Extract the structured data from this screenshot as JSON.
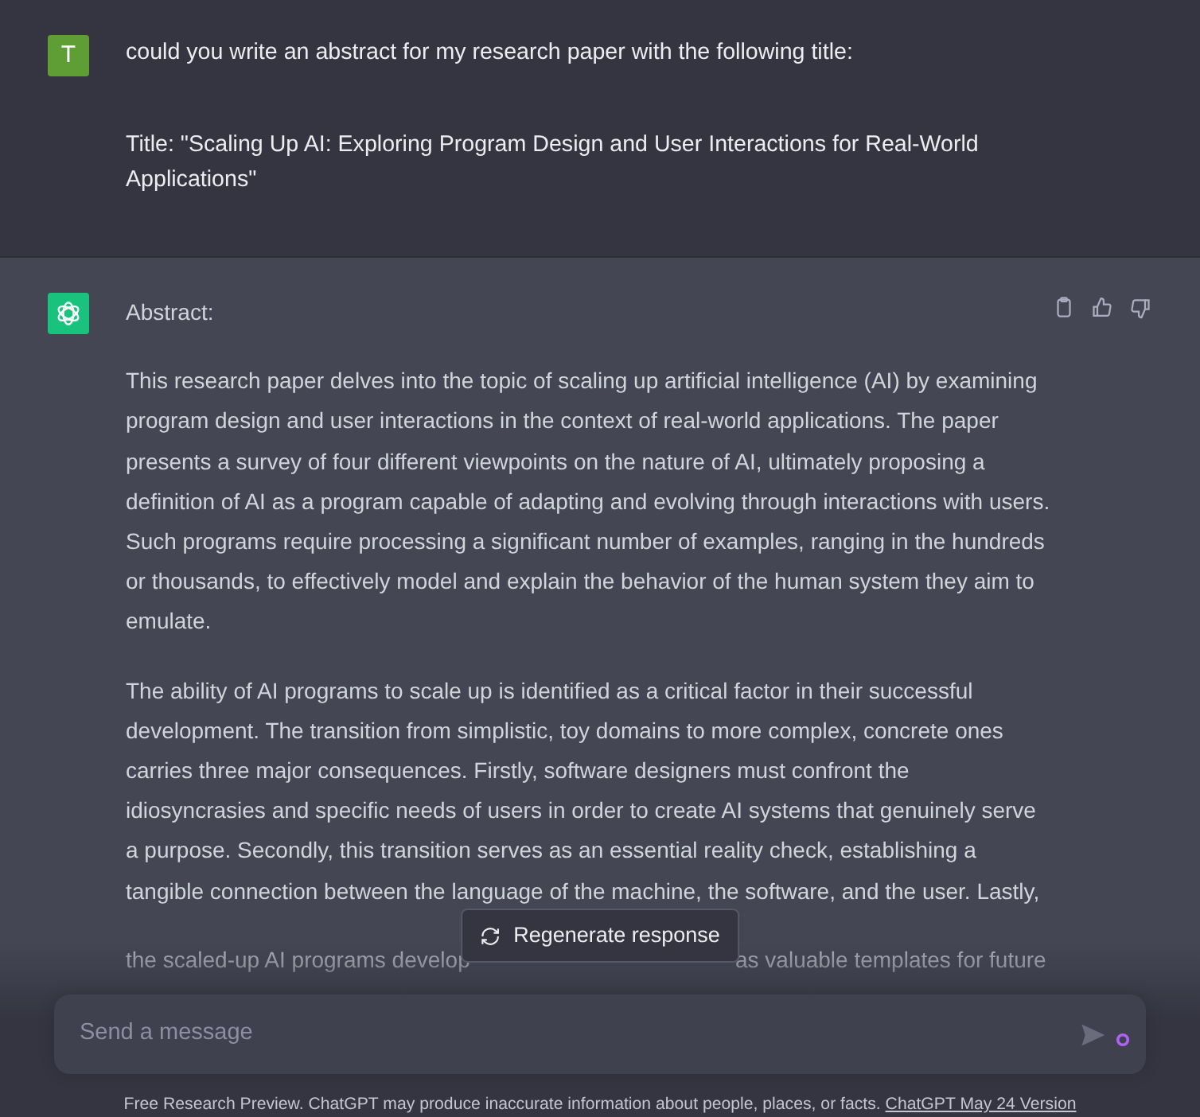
{
  "user_message": {
    "avatar": "T",
    "paragraphs": [
      "could you write an abstract for my research paper with the following title:",
      "Title: \"Scaling Up AI: Exploring Program Design and User Interactions for Real-World Applications\""
    ]
  },
  "assistant_message": {
    "heading": "Abstract:",
    "actions": [
      {
        "kind": "copy"
      },
      {
        "kind": "like"
      },
      {
        "kind": "dislike"
      }
    ],
    "paragraphs": [
      "This research paper delves into the topic of scaling up artificial intelligence (AI) by examining program design and user interactions in the context of real-world applications. The paper presents a survey of four different viewpoints on the nature of AI, ultimately proposing a definition of AI as a program capable of adapting and evolving through interactions with users. Such programs require processing a significant number of examples, ranging in the hundreds or thousands, to effectively model and explain the behavior of the human system they aim to emulate.",
      "The ability of AI programs to scale up is identified as a critical factor in their successful development. The transition from simplistic, toy domains to more complex, concrete ones carries three major consequences. Firstly, software designers must confront the idiosyncrasies and specific needs of users in order to create AI systems that genuinely serve a purpose. Secondly, this transition serves as an essential reality check, establishing a tangible connection between the language of the machine, the software, and the user. Lastly,"
    ],
    "faded_fragments": [
      "the scaled-up AI programs develop",
      "as valuable templates for future"
    ]
  },
  "regenerate_button": "Regenerate response",
  "composer": {
    "placeholder": "Send a message"
  },
  "footer": {
    "text": "Free Research Preview. ChatGPT may produce inaccurate information about people, places, or facts.",
    "link": "ChatGPT May 24 Version"
  }
}
